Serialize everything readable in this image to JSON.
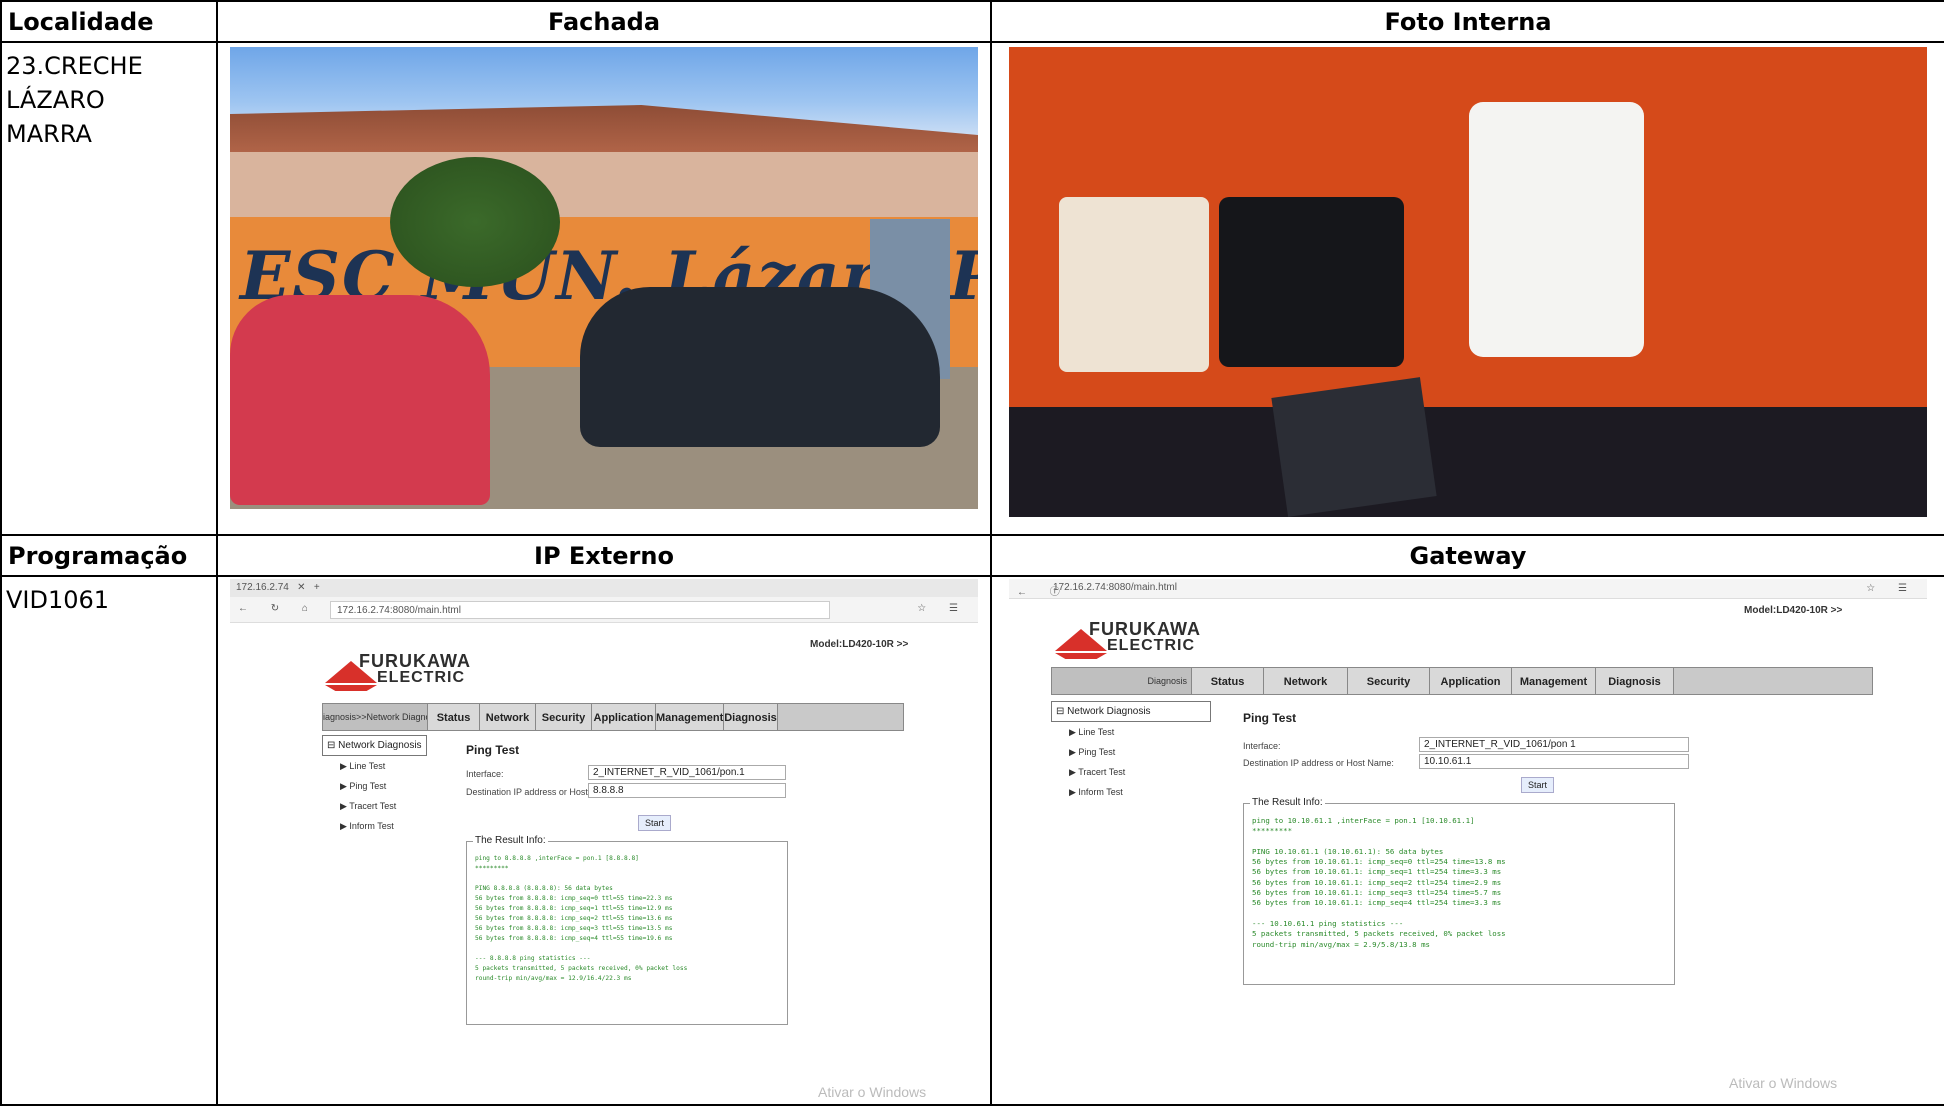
{
  "headers": {
    "row1": [
      "Localidade",
      "Fachada",
      "Foto Interna"
    ],
    "row2": [
      "Programação",
      "IP Externo",
      "Gateway"
    ]
  },
  "locality": "23.CRECHE\nLÁZARO\nMARRA",
  "programming": "VID1061",
  "facade": {
    "graffiti": "ESC MUN. Lázaro P. Marra"
  },
  "ext": {
    "tab_title": "172.16.2.74",
    "url": "172.16.2.74:8080/main.html",
    "brand_line1": "FURUKAWA",
    "brand_line2": "ELECTRIC",
    "model": "Model:LD420-10R >>",
    "crumb": "iagnosis>>Network Diagno",
    "tabs": [
      "Status",
      "Network",
      "Security",
      "Application",
      "Management",
      "Diagnosis"
    ],
    "side_head": "Network Diagnosis",
    "side_items": [
      "Line Test",
      "Ping Test",
      "Tracert Test",
      "Inform Test"
    ],
    "title": "Ping Test",
    "interface_label": "Interface:",
    "interface_value": "2_INTERNET_R_VID_1061/pon.1",
    "dest_label": "Destination IP address or Host Name:",
    "dest_value": "8.8.8.8",
    "start": "Start",
    "result_title": "The Result Info:",
    "result_text": "ping to 8.8.8.8 ,interFace = pon.1 [8.8.8.8]\n*********\n\nPING 8.8.8.8 (8.8.8.8): 56 data bytes\n56 bytes from 8.8.8.8: icmp_seq=0 ttl=55 time=22.3 ms\n56 bytes from 8.8.8.8: icmp_seq=1 ttl=55 time=12.9 ms\n56 bytes from 8.8.8.8: icmp_seq=2 ttl=55 time=13.6 ms\n56 bytes from 8.8.8.8: icmp_seq=3 ttl=55 time=13.5 ms\n56 bytes from 8.8.8.8: icmp_seq=4 ttl=55 time=19.6 ms\n\n--- 8.8.8.8 ping statistics ---\n5 packets transmitted, 5 packets received, 0% packet loss\nround-trip min/avg/max = 12.9/16.4/22.3 ms",
    "watermark": "Ativar o Windows"
  },
  "gw": {
    "url": "172.16.2.74:8080/main.html",
    "brand_line1": "FURUKAWA",
    "brand_line2": "ELECTRIC",
    "model": "Model:LD420-10R >>",
    "crumb": "Diagnosis",
    "tabs": [
      "Status",
      "Network",
      "Security",
      "Application",
      "Management",
      "Diagnosis"
    ],
    "side_head": "Network Diagnosis",
    "side_items": [
      "Line Test",
      "Ping Test",
      "Tracert Test",
      "Inform Test"
    ],
    "title": "Ping Test",
    "interface_label": "Interface:",
    "interface_value": "2_INTERNET_R_VID_1061/pon 1",
    "dest_label": "Destination IP address or Host Name:",
    "dest_value": "10.10.61.1",
    "start": "Start",
    "result_title": "The Result Info:",
    "result_text": "ping to 10.10.61.1 ,interFace = pon.1 [10.10.61.1]\n*********\n\nPING 10.10.61.1 (10.10.61.1): 56 data bytes\n56 bytes from 10.10.61.1: icmp_seq=0 ttl=254 time=13.8 ms\n56 bytes from 10.10.61.1: icmp_seq=1 ttl=254 time=3.3 ms\n56 bytes from 10.10.61.1: icmp_seq=2 ttl=254 time=2.9 ms\n56 bytes from 10.10.61.1: icmp_seq=3 ttl=254 time=5.7 ms\n56 bytes from 10.10.61.1: icmp_seq=4 ttl=254 time=3.3 ms\n\n--- 10.10.61.1 ping statistics ---\n5 packets transmitted, 5 packets received, 0% packet loss\nround-trip min/avg/max = 2.9/5.8/13.8 ms",
    "watermark": "Ativar o Windows"
  }
}
